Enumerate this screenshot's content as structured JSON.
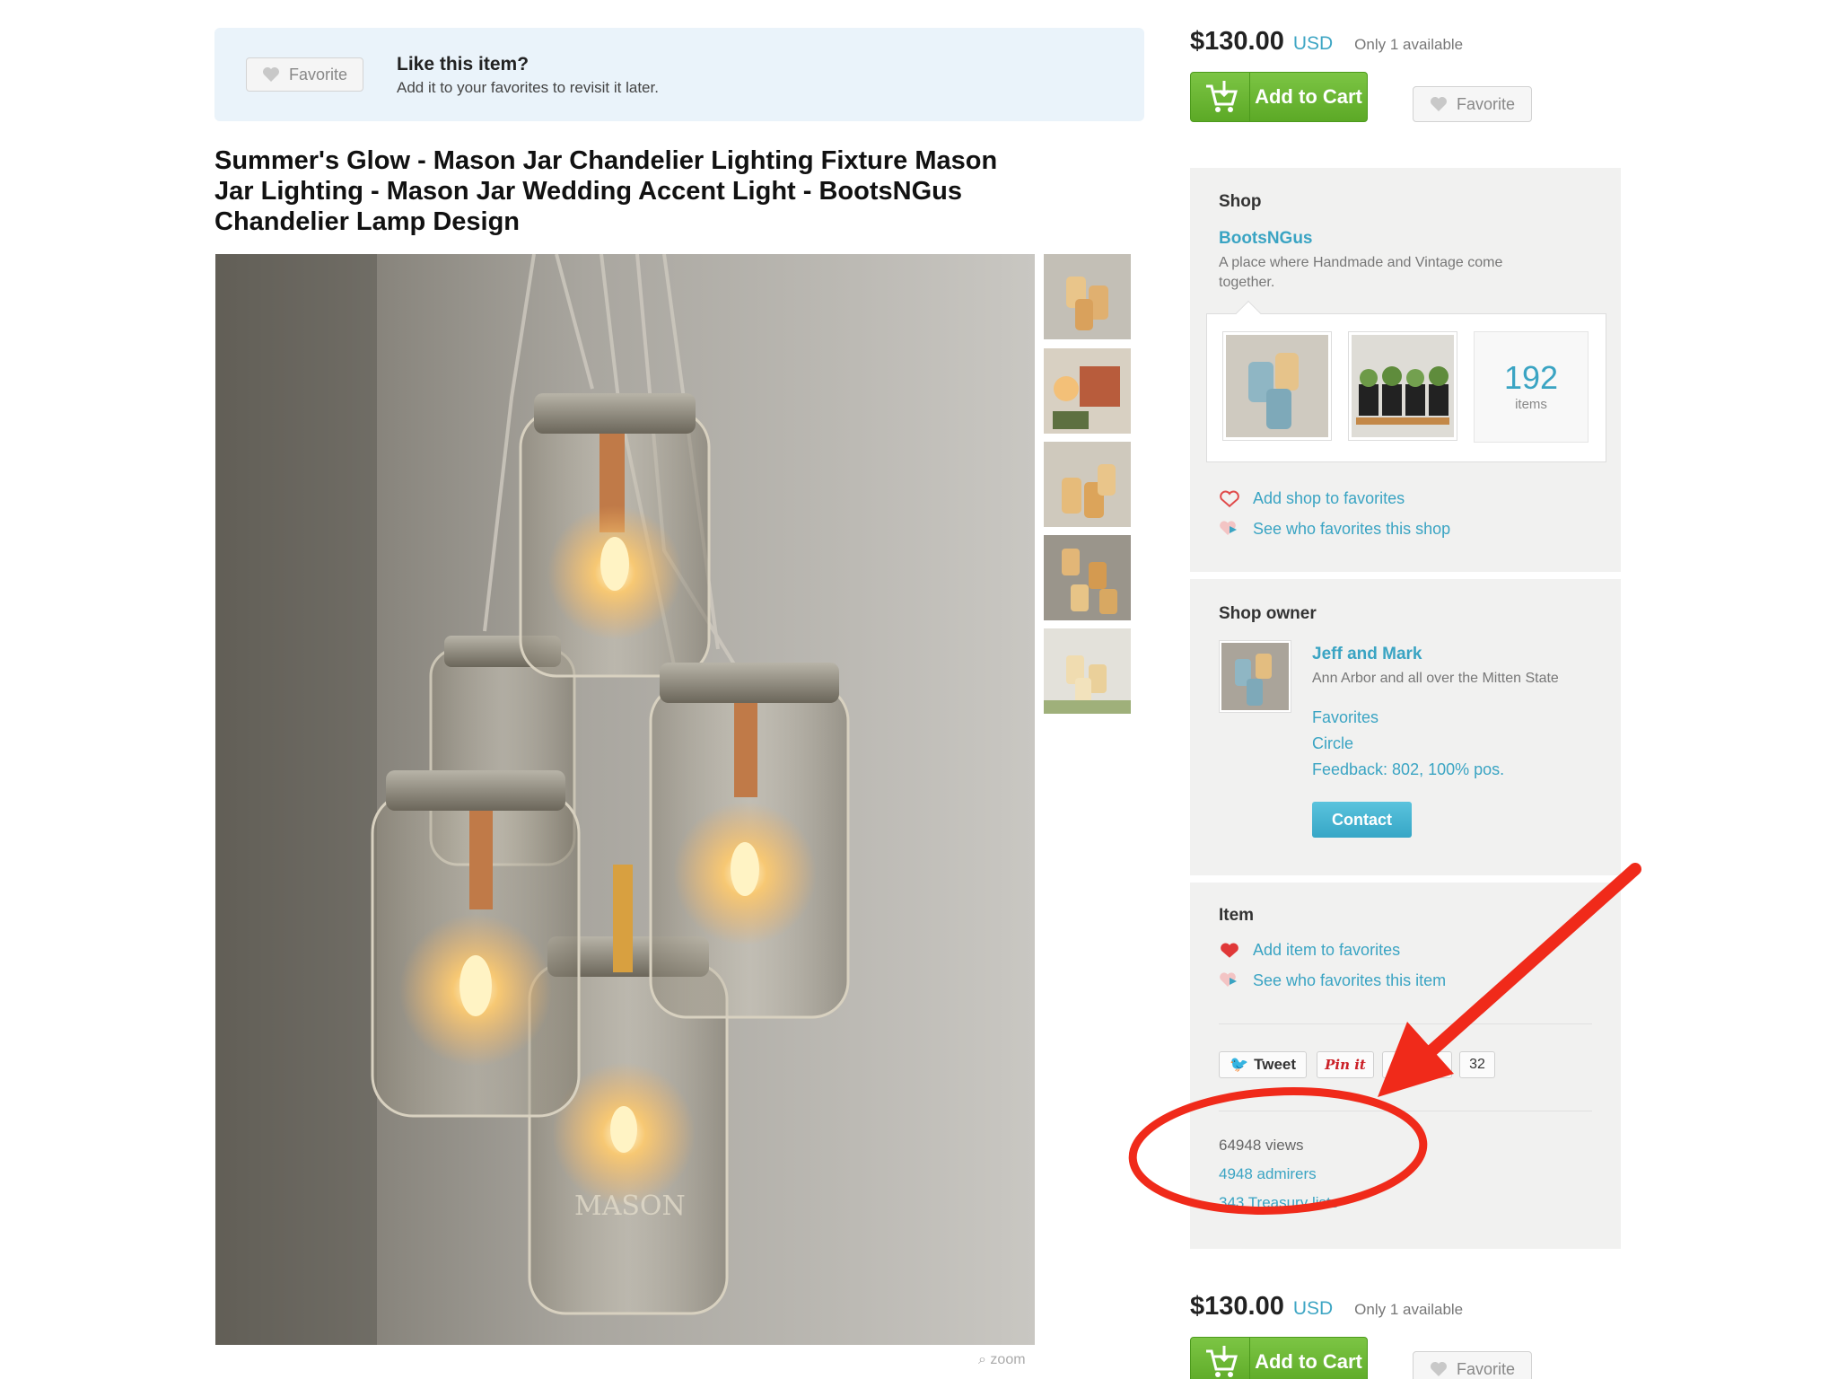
{
  "favorite_banner": {
    "button_label": "Favorite",
    "title": "Like this item?",
    "subtitle": "Add it to your favorites to revisit it later."
  },
  "listing": {
    "title": "Summer's Glow - Mason Jar Chandelier Lighting Fixture Mason Jar Lighting - Mason Jar Wedding Accent Light - BootsNGus Chandelier Lamp Design",
    "zoom_label": "zoom",
    "thumbnail_count": 5
  },
  "purchase_top": {
    "price": "$130.00",
    "currency": "USD",
    "availability": "Only 1 available",
    "cart_label": "Add to Cart",
    "favorite_label": "Favorite"
  },
  "shop": {
    "heading": "Shop",
    "name": "BootsNGus",
    "description": "A place where Handmade and Vintage come together.",
    "items_count": "192",
    "items_label": "items",
    "add_favorites": "Add shop to favorites",
    "see_who": "See who favorites this shop"
  },
  "owner": {
    "heading": "Shop owner",
    "name": "Jeff and Mark",
    "location": "Ann Arbor and all over the Mitten State",
    "favorites_link": "Favorites",
    "circle_link": "Circle",
    "feedback": "Feedback: 802, 100% pos.",
    "contact_label": "Contact"
  },
  "item": {
    "heading": "Item",
    "add_favorites": "Add item to favorites",
    "see_who": "See who favorites this item",
    "tweet_label": "Tweet",
    "pin_label": "Pin it",
    "like_label": "Like",
    "like_count": "32",
    "views": "64948 views",
    "admirers": "4948 admirers",
    "treasury": "343 Treasury lists"
  },
  "purchase_bottom": {
    "price": "$130.00",
    "currency": "USD",
    "availability": "Only 1 available",
    "cart_label": "Add to Cart",
    "favorite_label": "Favorite"
  },
  "colors": {
    "link": "#3aa4c3",
    "cart_green": "#6cba33",
    "annotation_red": "#f02a1a",
    "banner_bg": "#eaf3fa",
    "panel_bg": "#f1f1f0"
  }
}
